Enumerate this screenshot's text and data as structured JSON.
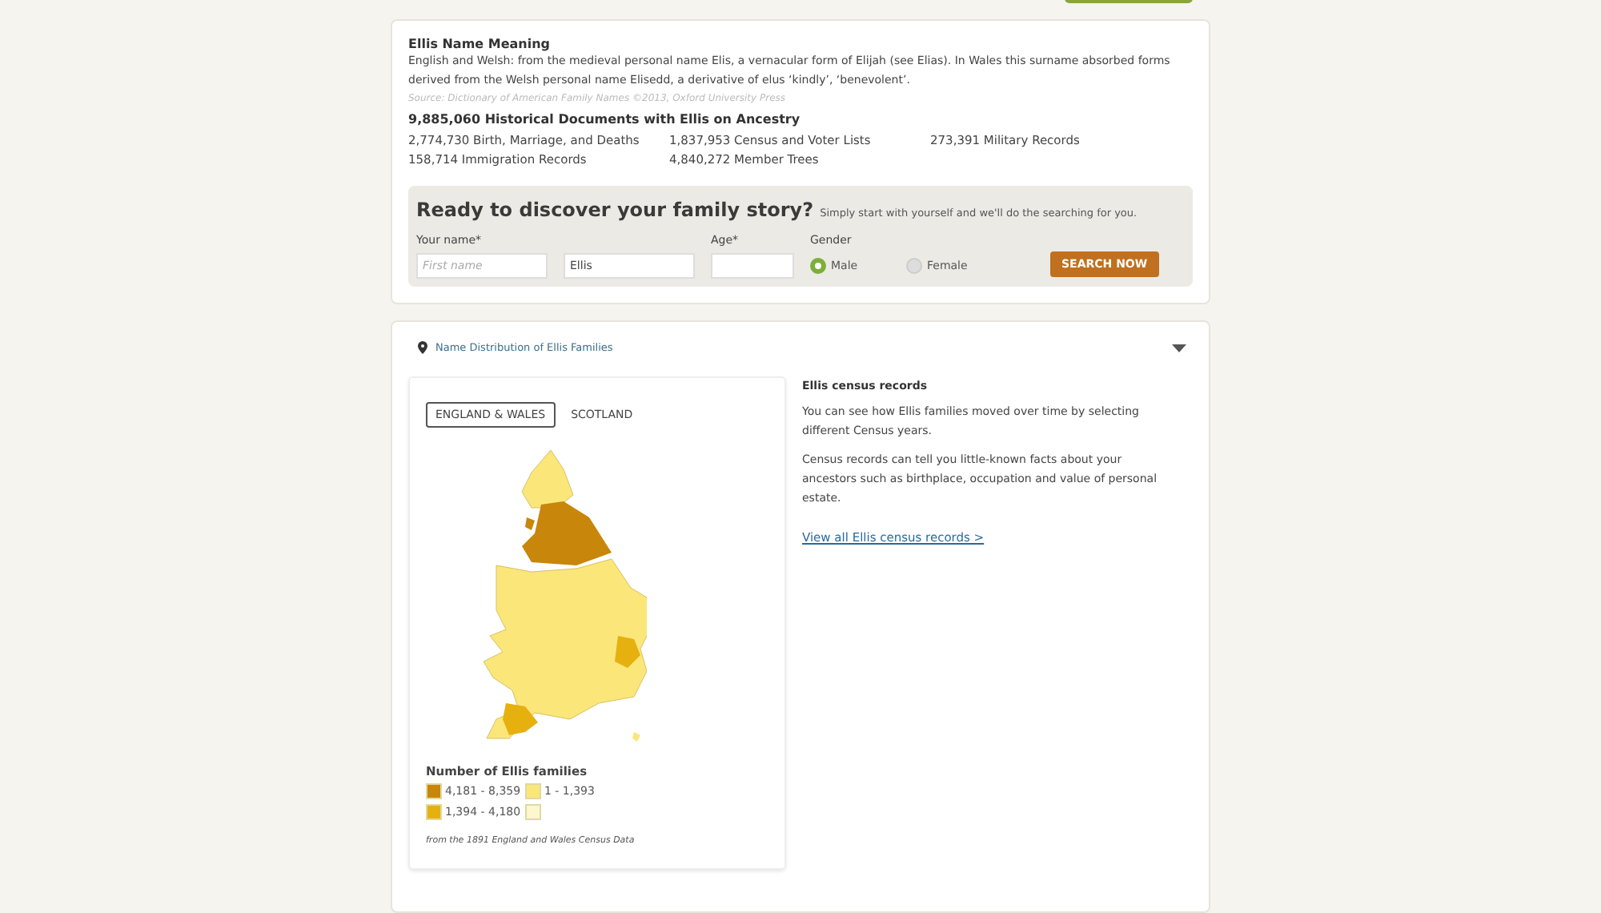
{
  "meaning": {
    "title": "Ellis Name Meaning",
    "text": "English and Welsh: from the medieval personal name Elis, a vernacular form of Elijah (see Elias). In Wales this surname absorbed forms derived from the Welsh personal name Elisedd, a derivative of elus ‘kindly’, ‘benevolent’.",
    "source": "Source: Dictionary of American Family Names ©2013, Oxford University Press"
  },
  "documents": {
    "title": "9,885,060 Historical Documents with Ellis on Ancestry",
    "items": [
      "2,774,730 Birth, Marriage, and Deaths",
      "1,837,953 Census and Voter Lists",
      "273,391 Military Records",
      "158,714 Immigration Records",
      "4,840,272 Member Trees"
    ]
  },
  "search": {
    "heading": "Ready to discover your family story?",
    "subheading": "Simply start with yourself and we'll do the searching for you.",
    "name_label": "Your name*",
    "first_name": {
      "placeholder": "First name"
    },
    "last_name": {
      "value": "Ellis"
    },
    "age_label": "Age*",
    "gender_label": "Gender",
    "genders": [
      {
        "label": "Male",
        "selected": true
      },
      {
        "label": "Female",
        "selected": false
      }
    ],
    "button": "SEARCH NOW"
  },
  "distribution": {
    "title": "Name Distribution of Ellis Families",
    "expanded": true,
    "tabs": [
      {
        "label": "ENGLAND & WALES",
        "selected": true
      },
      {
        "label": "SCOTLAND",
        "selected": false
      }
    ],
    "legend_title": "Number of Ellis families",
    "legend": [
      {
        "label": "4,181 - 8,359",
        "color": "#c8860a"
      },
      {
        "label": "1 - 1,393",
        "color": "#fbe67a"
      },
      {
        "label": "1,394 - 4,180",
        "color": "#e6b00f"
      },
      {
        "color": "#fdf7cf"
      }
    ],
    "note": "from the 1891 England and Wales Census Data",
    "info_title": "Ellis census records",
    "paragraphs": [
      "You can see how Ellis families moved over time by selecting different Census years.",
      "Census records can tell you little-known facts about your ancestors such as birthplace, occupation and value of personal estate."
    ],
    "link": "View all Ellis census records >"
  }
}
